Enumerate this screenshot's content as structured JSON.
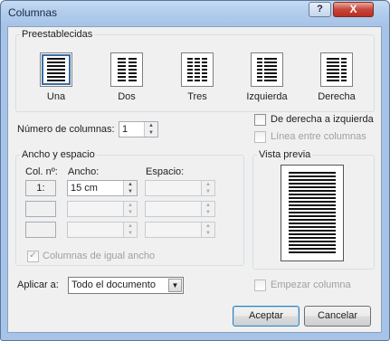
{
  "window": {
    "title": "Columnas",
    "help_label": "?",
    "close_label": "X"
  },
  "presets": {
    "title": "Preestablecidas",
    "items": [
      {
        "label": "Una",
        "key": "U"
      },
      {
        "label": "Dos",
        "key": "D"
      },
      {
        "label": "Tres",
        "key": "T"
      },
      {
        "label": "Izquierda",
        "key": "I"
      },
      {
        "label": "Derecha",
        "key": "D"
      }
    ],
    "selected": "Una"
  },
  "num_columns": {
    "label": "Número de columnas:",
    "value": "1"
  },
  "right_to_left": {
    "label": "De derecha a izquierda",
    "checked": false
  },
  "line_between": {
    "label": "Línea entre columnas",
    "checked": false,
    "enabled": false
  },
  "width_spacing": {
    "title": "Ancho y espacio",
    "col_header": "Col. nº:",
    "width_header": "Ancho:",
    "spacing_header": "Espacio:",
    "rows": [
      {
        "col": "1:",
        "width": "15 cm",
        "spacing": ""
      },
      {
        "col": "",
        "width": "",
        "spacing": ""
      },
      {
        "col": "",
        "width": "",
        "spacing": ""
      }
    ],
    "equal_width": {
      "label": "Columnas de igual ancho",
      "checked": true,
      "enabled": false
    }
  },
  "preview": {
    "title": "Vista previa"
  },
  "apply_to": {
    "label": "Aplicar a:",
    "value": "Todo el documento"
  },
  "start_column": {
    "label": "Empezar columna",
    "checked": false,
    "enabled": false
  },
  "buttons": {
    "ok": "Aceptar",
    "cancel": "Cancelar"
  }
}
